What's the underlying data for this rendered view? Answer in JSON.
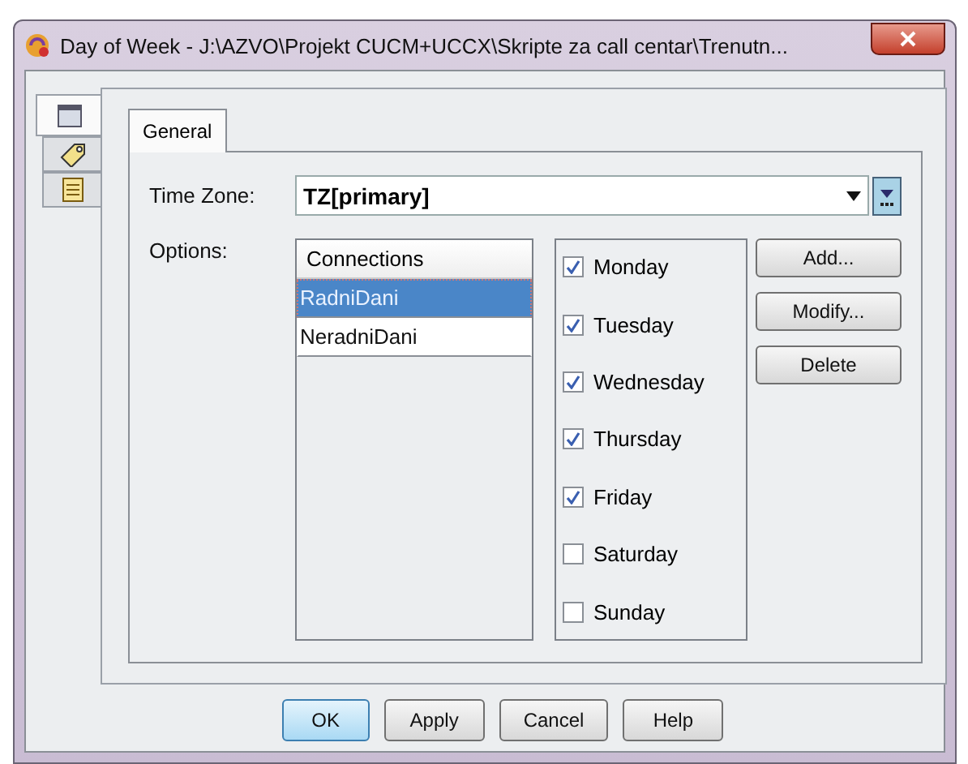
{
  "window": {
    "title": "Day of Week - J:\\AZVO\\Projekt CUCM+UCCX\\Skripte za call centar\\Trenutn..."
  },
  "side_tabs": [
    {
      "kind": "calendar",
      "selected": true
    },
    {
      "kind": "tag",
      "selected": false
    },
    {
      "kind": "document",
      "selected": false
    }
  ],
  "tabs": [
    {
      "label": "General",
      "selected": true
    }
  ],
  "time_zone": {
    "label": "Time Zone:",
    "value": "TZ[primary]"
  },
  "options": {
    "label": "Options:",
    "list_header": "Connections",
    "items": [
      {
        "label": "RadniDani",
        "selected": true
      },
      {
        "label": "NeradniDani",
        "selected": false
      }
    ]
  },
  "days": [
    {
      "label": "Monday",
      "checked": true
    },
    {
      "label": "Tuesday",
      "checked": true
    },
    {
      "label": "Wednesday",
      "checked": true
    },
    {
      "label": "Thursday",
      "checked": true
    },
    {
      "label": "Friday",
      "checked": true
    },
    {
      "label": "Saturday",
      "checked": false
    },
    {
      "label": "Sunday",
      "checked": false
    }
  ],
  "side_buttons": [
    "Add...",
    "Modify...",
    "Delete"
  ],
  "buttons": [
    {
      "label": "OK",
      "default": true
    },
    {
      "label": "Apply",
      "default": false
    },
    {
      "label": "Cancel",
      "default": false
    },
    {
      "label": "Help",
      "default": false
    }
  ]
}
